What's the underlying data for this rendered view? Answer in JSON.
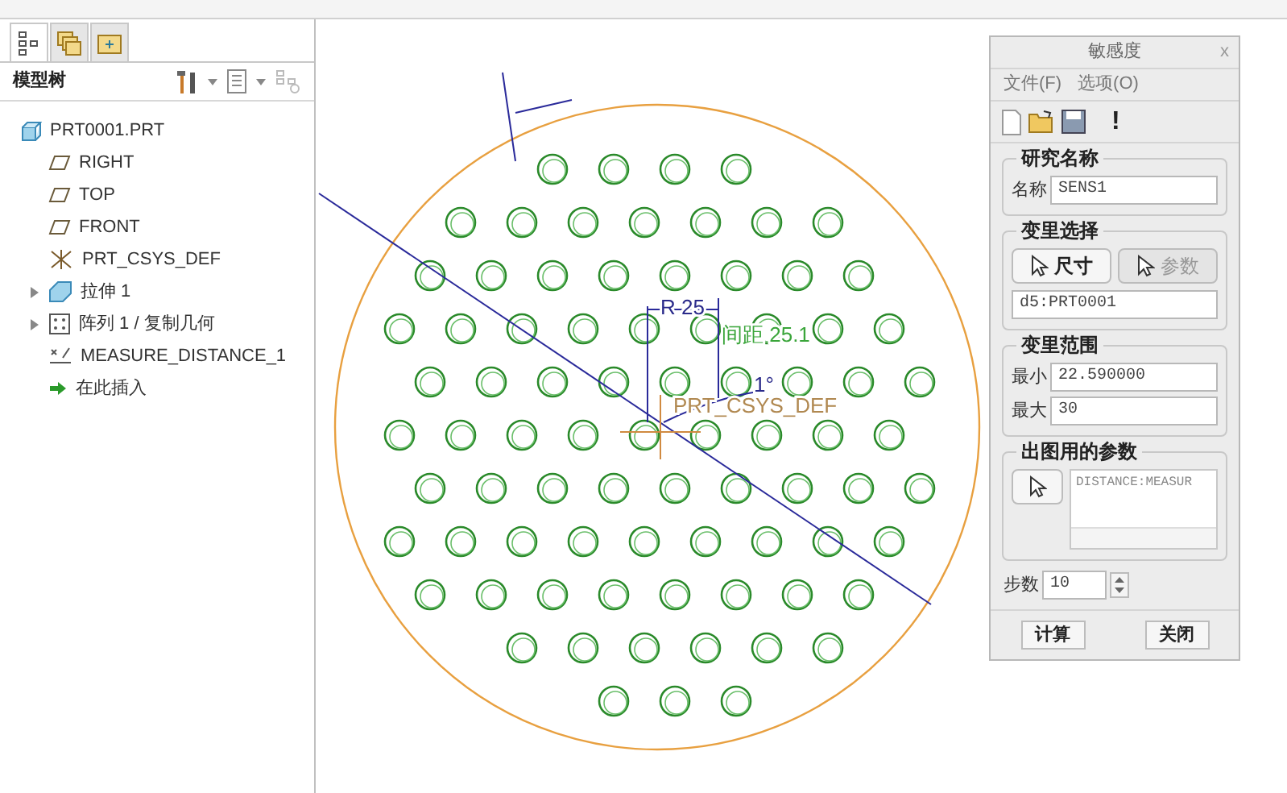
{
  "panel_tabs": [
    {
      "kind": "tree",
      "selected": true
    },
    {
      "kind": "layers",
      "selected": false
    },
    {
      "kind": "folder",
      "selected": false
    }
  ],
  "model_tree": {
    "title": "模型树",
    "items": [
      {
        "kind": "part",
        "label": "PRT0001.PRT",
        "expandable": false
      },
      {
        "kind": "plane",
        "label": "RIGHT",
        "expandable": false
      },
      {
        "kind": "plane",
        "label": "TOP",
        "expandable": false
      },
      {
        "kind": "plane",
        "label": "FRONT",
        "expandable": false
      },
      {
        "kind": "csys",
        "label": "PRT_CSYS_DEF",
        "expandable": false
      },
      {
        "kind": "extrude",
        "label": "拉伸 1",
        "expandable": true
      },
      {
        "kind": "pattern",
        "label": "阵列 1 / 复制几何",
        "expandable": true
      },
      {
        "kind": "measure",
        "label": "MEASURE_DISTANCE_1",
        "expandable": false
      },
      {
        "kind": "insert",
        "label": "在此插入",
        "expandable": false
      }
    ]
  },
  "canvas": {
    "labels": [
      {
        "kind": "dim",
        "text": "R 25"
      },
      {
        "kind": "green",
        "text": "间距 25.1"
      },
      {
        "kind": "dim",
        "text": "1°"
      },
      {
        "kind": "csys",
        "text": "PRT_CSYS_DEF"
      }
    ]
  },
  "dialog": {
    "title": "敏感度",
    "close": "x",
    "menus": [
      "文件(F)",
      "选项(O)"
    ],
    "toolbar_mark": "!",
    "study": {
      "title": "研究名称",
      "label": "名称",
      "value": "SENS1"
    },
    "variable": {
      "title": "变里选择",
      "buttons": [
        {
          "label": "尺寸",
          "disabled": false
        },
        {
          "label": "参数",
          "disabled": true
        }
      ],
      "value": "d5:PRT0001"
    },
    "range": {
      "title": "变里范围",
      "min_label": "最小",
      "min": "22.590000",
      "max_label": "最大",
      "max": "30"
    },
    "plot_params": {
      "title": "出图用的参数",
      "items": [
        "DISTANCE:MEASUR"
      ]
    },
    "steps": {
      "label": "步数",
      "value": "10"
    },
    "buttons": [
      "计算",
      "关闭"
    ]
  }
}
